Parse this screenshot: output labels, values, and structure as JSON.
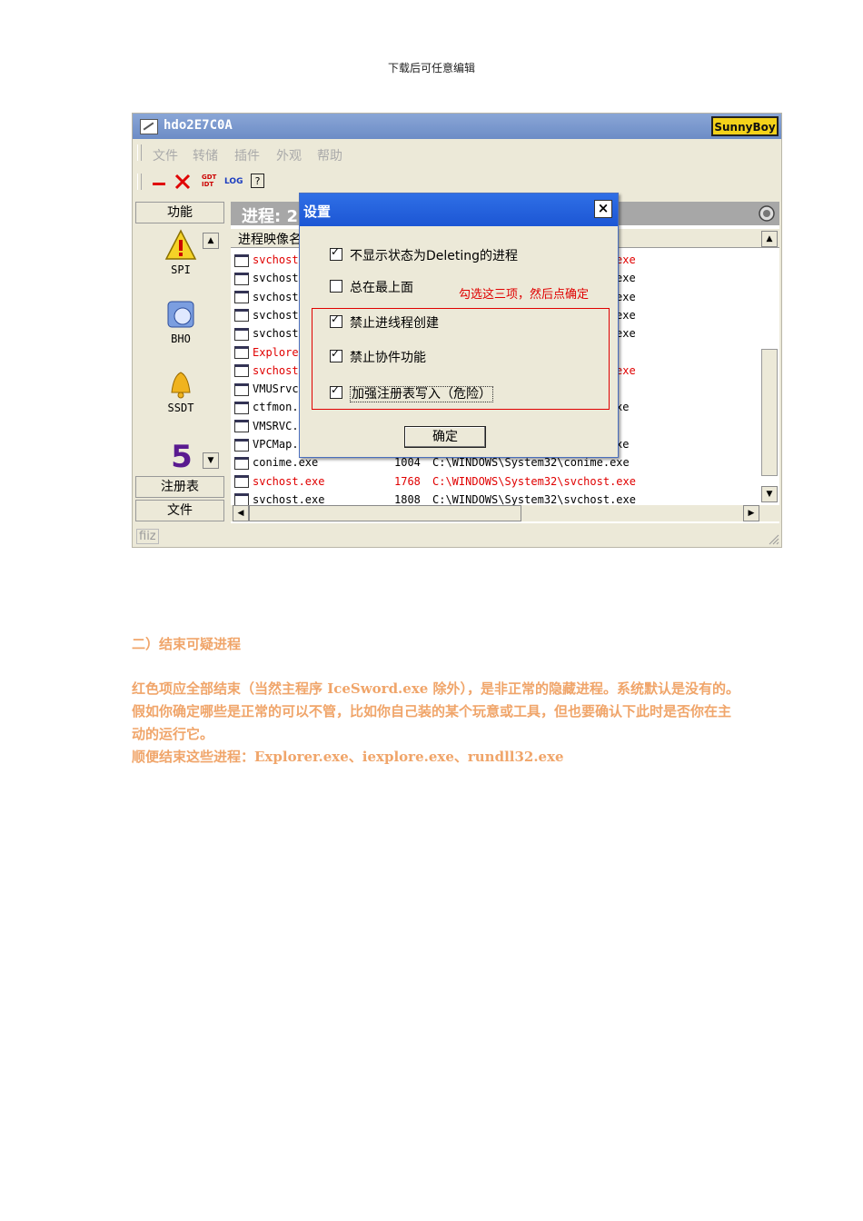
{
  "header": {
    "text": "下载后可任意编辑"
  },
  "app": {
    "title": "hdo2E7C0A",
    "brand": "SunnyBoy",
    "menu": [
      "文件",
      "转储",
      "插件",
      "外观",
      "帮助"
    ],
    "toolbar": {
      "gdt": "GDT\nIDT",
      "log": "LOG",
      "help": "?"
    },
    "left_panel": {
      "top_button": "功能",
      "items": [
        "SPI",
        "BHO",
        "SSDT"
      ],
      "bottom_buttons": [
        "注册表",
        "文件"
      ]
    },
    "main": {
      "process_label": "进程: 2",
      "column_header": "进程映像名",
      "rows": [
        {
          "name": "svchost",
          "red": true,
          "tail": "exe"
        },
        {
          "name": "svchost",
          "red": false,
          "tail": "exe"
        },
        {
          "name": "svchost",
          "red": false,
          "tail": "exe"
        },
        {
          "name": "svchost",
          "red": false,
          "tail": "exe"
        },
        {
          "name": "svchost",
          "red": false,
          "tail": "exe"
        },
        {
          "name": "Explore",
          "red": true,
          "tail": ""
        },
        {
          "name": "svchost",
          "red": true,
          "tail": "exe"
        },
        {
          "name": "VMUSrvc",
          "red": false,
          "tail": ""
        },
        {
          "name": "ctfmon.",
          "red": false,
          "tail": "xe"
        },
        {
          "name": "VMSRVC.",
          "red": false,
          "tail": ""
        },
        {
          "name": "VPCMap.",
          "red": false,
          "tail": "xe"
        },
        {
          "name": "conime.exe",
          "red": false,
          "pid": "1004",
          "path": "C:\\WINDOWS\\System32\\conime.exe"
        },
        {
          "name": "svchost.exe",
          "red": true,
          "pid": "1768",
          "path": "C:\\WINDOWS\\System32\\svchost.exe"
        },
        {
          "name": "svchost.exe",
          "red": false,
          "pid": "1808",
          "path": "C:\\WINDOWS\\System32\\svchost.exe"
        }
      ]
    },
    "status": "fiiz"
  },
  "dialog": {
    "title": "设置",
    "close": "×",
    "options": [
      {
        "label": "不显示状态为Deleting的进程",
        "checked": true
      },
      {
        "label": "总在最上面",
        "checked": false
      },
      {
        "label": "禁止进线程创建",
        "checked": true
      },
      {
        "label": "禁止协件功能",
        "checked": true
      },
      {
        "label": "加强注册表写入（危险）",
        "checked": true
      }
    ],
    "note": "勾选这三项，然后点确定",
    "ok": "确定"
  },
  "section": {
    "heading": "二）结束可疑进程",
    "para1": "红色项应全部结束（当然主程序 IceSword.exe 除外），是非正常的隐藏进程。系统默认是没有的。假如你确定哪些是正常的可以不管，比如你自己装的某个玩意或工具，但也要确认下此时是否你在主动的运行它。",
    "para2": "顺便结束这些进程：Explorer.exe、iexplore.exe、rundll32.exe"
  }
}
